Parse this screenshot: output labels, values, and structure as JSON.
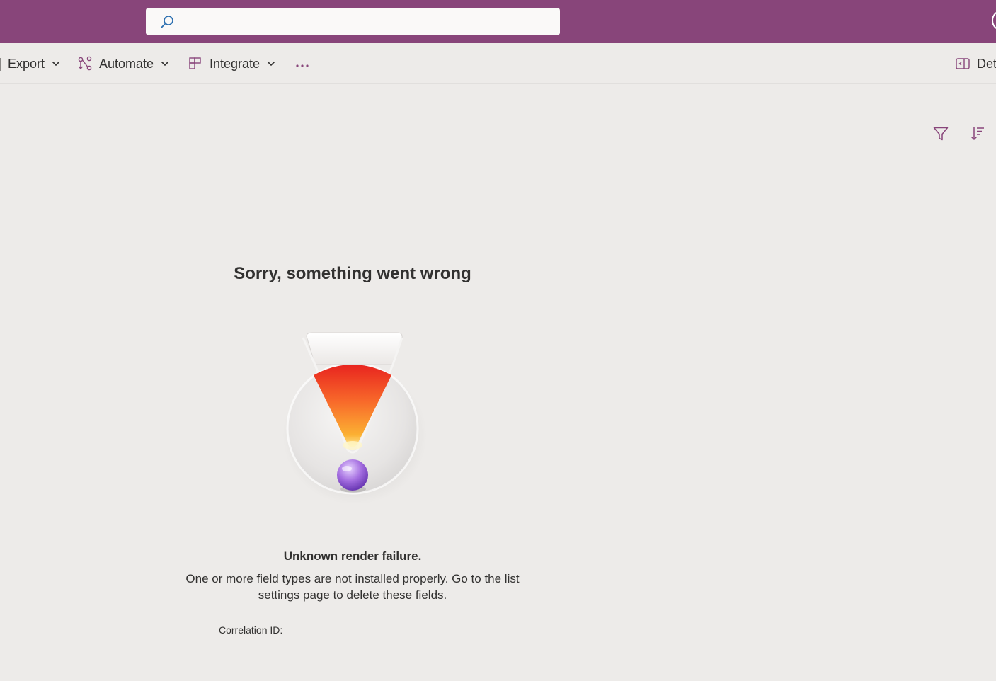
{
  "suite_bar": {
    "background_color": "#88457a",
    "search": {
      "placeholder": "",
      "value": "",
      "icon": "search-icon"
    },
    "avatar_icon": "avatar"
  },
  "command_bar": {
    "export": {
      "label": "Export",
      "chevron_icon": "chevron-down-icon"
    },
    "automate": {
      "label": "Automate",
      "icon": "automate-icon",
      "chevron_icon": "chevron-down-icon"
    },
    "integrate": {
      "label": "Integrate",
      "icon": "integrate-icon",
      "chevron_icon": "chevron-down-icon"
    },
    "more": {
      "label": "···",
      "icon": "more-icon"
    },
    "details": {
      "label": "Det",
      "icon": "details-pane-icon"
    }
  },
  "view_tools": {
    "filter_icon": "filter-icon",
    "sort_icon": "sort-icon",
    "icon_color": "#88457a"
  },
  "error": {
    "title": "Sorry, something went wrong",
    "illustration": "error-illustration",
    "subtitle": "Unknown render failure.",
    "message": "One or more field types are not installed properly. Go to the list settings page to delete these fields.",
    "correlation_label": "Correlation ID:"
  }
}
